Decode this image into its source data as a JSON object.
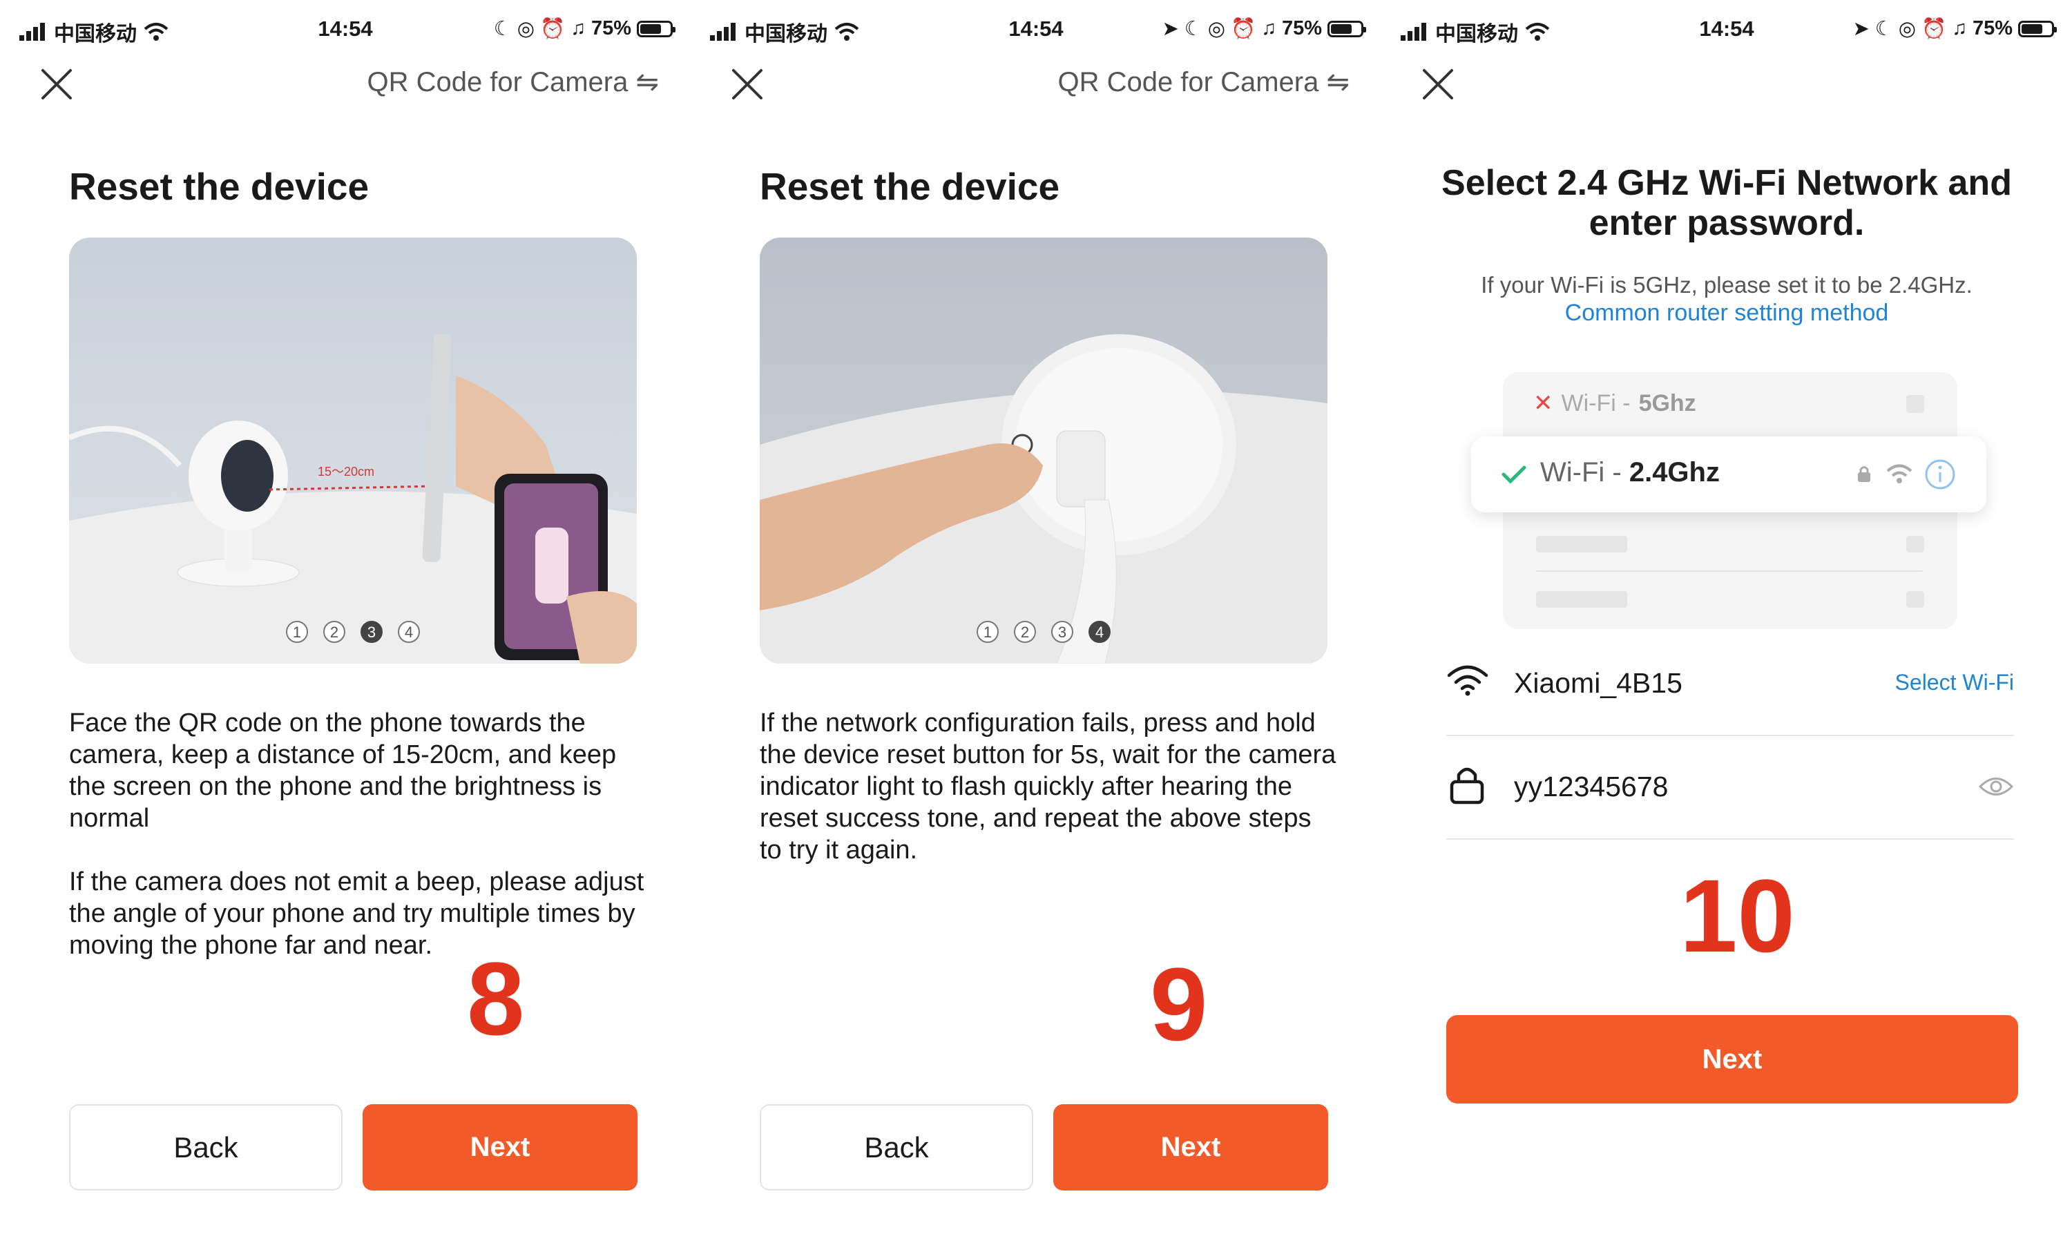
{
  "status_bar": {
    "carrier": "中国移动",
    "time": "14:54",
    "battery": "75%"
  },
  "nav": {
    "title": "QR Code for Camera ⇋"
  },
  "screens": [
    {
      "heading": "Reset the device",
      "photo_steps": [
        "1",
        "2",
        "3",
        "4"
      ],
      "active_step": 3,
      "photo_label": "15～20cm",
      "description": "Face the QR code on the phone towards the camera, keep a distance of 15-20cm, and keep the screen on the phone and the brightness is normal\n\nIf the camera does not emit a beep, please adjust the angle of your phone and try multiple times by moving the phone far and near.",
      "step_number": "8",
      "back_label": "Back",
      "next_label": "Next"
    },
    {
      "heading": "Reset the device",
      "photo_steps": [
        "1",
        "2",
        "3",
        "4"
      ],
      "active_step": 4,
      "description": "If the network configuration fails, press and hold the device reset button for 5s, wait for the camera indicator light to flash quickly after hearing the reset success tone, and repeat the above steps to try it again.",
      "step_number": "9",
      "back_label": "Back",
      "next_label": "Next"
    },
    {
      "heading": "Select 2.4 GHz Wi-Fi Network and enter password.",
      "hint": "If your Wi-Fi is 5GHz, please set it to be 2.4GHz.",
      "router_link": "Common router setting method",
      "wifi_5g": {
        "prefix": "Wi-Fi - ",
        "band": "5Ghz"
      },
      "wifi_24g": {
        "prefix": "Wi-Fi - ",
        "band": "2.4Ghz"
      },
      "network_name": "Xiaomi_4B15",
      "select_wifi_label": "Select Wi-Fi",
      "password": "yy12345678",
      "step_number": "10",
      "next_label": "Next"
    }
  ],
  "colors": {
    "accent": "#f35a29",
    "link": "#1d84d6",
    "step_number": "#e2341d"
  }
}
